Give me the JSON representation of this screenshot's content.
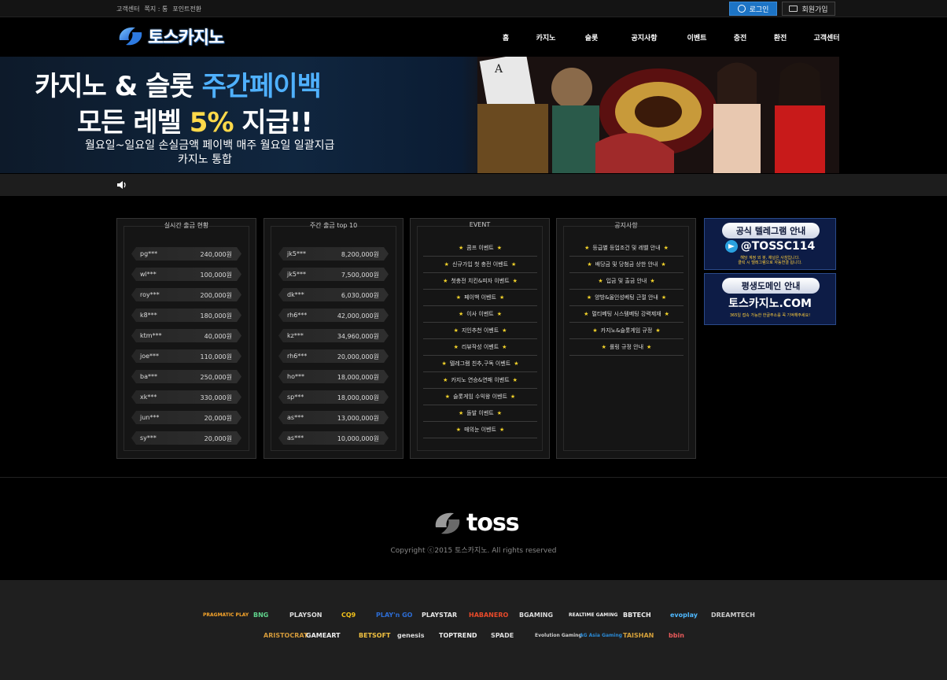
{
  "topbar": {
    "links": [
      "고객센터",
      "쪽지 : 통",
      "포인트전환"
    ],
    "login_label": "로그인",
    "join_label": "회원가입"
  },
  "header": {
    "logo_text": "토스카지노",
    "nav": [
      "홈",
      "카지노",
      "슬롯",
      "공지사항",
      "이벤트",
      "충전",
      "환전",
      "고객센터"
    ]
  },
  "banner": {
    "line1_a": "카지노 & 슬롯 ",
    "line1_b": "주간페이백",
    "line2_a": "모든 레벨 ",
    "line2_b": "5%",
    "line2_c": " 지급!!",
    "line3": "월요일~일요일 손실금액 페이백 매주 월요일 일괄지급",
    "line4": "카지노 통합"
  },
  "panels": {
    "withdraw_live": {
      "title": "실시간 출금 현황",
      "rows": [
        {
          "name": "pg***",
          "amount": "240,000원"
        },
        {
          "name": "wl***",
          "amount": "100,000원"
        },
        {
          "name": "roy***",
          "amount": "200,000원"
        },
        {
          "name": "k8***",
          "amount": "180,000원"
        },
        {
          "name": "ktm***",
          "amount": "40,000원"
        },
        {
          "name": "joe***",
          "amount": "110,000원"
        },
        {
          "name": "ba***",
          "amount": "250,000원"
        },
        {
          "name": "xk***",
          "amount": "330,000원"
        },
        {
          "name": "jun***",
          "amount": "20,000원"
        },
        {
          "name": "sy***",
          "amount": "20,000원"
        }
      ]
    },
    "weekly_top": {
      "title": "주간 출금 top 10",
      "rows": [
        {
          "name": "jk5***",
          "amount": "8,200,000원"
        },
        {
          "name": "jk5***",
          "amount": "7,500,000원"
        },
        {
          "name": "dk***",
          "amount": "6,030,000원"
        },
        {
          "name": "rh6***",
          "amount": "42,000,000원"
        },
        {
          "name": "kz***",
          "amount": "34,960,000원"
        },
        {
          "name": "rh6***",
          "amount": "20,000,000원"
        },
        {
          "name": "ho***",
          "amount": "18,000,000원"
        },
        {
          "name": "sp***",
          "amount": "18,000,000원"
        },
        {
          "name": "as***",
          "amount": "13,000,000원"
        },
        {
          "name": "as***",
          "amount": "10,000,000원"
        }
      ]
    },
    "event": {
      "title": "EVENT",
      "items": [
        "콤프 이벤트",
        "신규가입 첫 충전 이벤트",
        "첫충전 치킨&피자 이벤트",
        "페이백 이벤트",
        "이사 이벤트",
        "지인추천 이벤트",
        "리뷰작성 이벤트",
        "텔레그램 친추,구독 이벤트",
        "카지노 연승&연패 이벤트",
        "슬롯게임 수익왕 이벤트",
        "돌발 이벤트",
        "매의눈 이벤트"
      ]
    },
    "notice": {
      "title": "공지사항",
      "items": [
        "등급별 등업조건 및 레벨 안내",
        "배당금 및 당첨금 상한 안내",
        "입금 및 출금 안내",
        "양방&올인성베팅 근절 안내",
        "멀티베팅 시스템베팅 강력제재",
        "카지노&슬롯게임 규정",
        "롤링 규정 안내"
      ]
    }
  },
  "promos": {
    "telegram": {
      "title": "공식 텔레그램 안내",
      "handle": "@TOSSC114",
      "small1": "해당 계정 외 봇, 채널은 사칭입니다.",
      "small2": "클릭 시 텔레그램으로 자동연결 됩니다."
    },
    "domain": {
      "title": "평생도메인 안내",
      "domain": "토스카지노.COM",
      "small1": "365일 접속 가능한 한글주소를 꼭 기억해주세요!"
    }
  },
  "footer": {
    "logo_text": "toss",
    "copyright": "Copyright ⓒ2015 토스카지노. All rights reserved"
  },
  "providers_row1": [
    {
      "label": "PRAGMATIC PLAY",
      "color": "#f7a52b"
    },
    {
      "label": "BNG",
      "color": "#5fd38b"
    },
    {
      "label": "PLAYSON",
      "color": "#dddddd"
    },
    {
      "label": "CQ9",
      "color": "#f3c21a"
    },
    {
      "label": "PLAY'n GO",
      "color": "#2d6dd4"
    },
    {
      "label": "PLAYSTAR",
      "color": "#e6e6e6"
    },
    {
      "label": "HABANERO",
      "color": "#e84a2a"
    },
    {
      "label": "BGAMING",
      "color": "#dddddd"
    },
    {
      "label": "REALTIME GAMING",
      "color": "#eeeeee"
    },
    {
      "label": "BBTECH",
      "color": "#eeeeee"
    },
    {
      "label": "evoplay",
      "color": "#4fb9ff"
    },
    {
      "label": "DREAMTECH",
      "color": "#cccccc"
    }
  ],
  "providers_row2": [
    {
      "label": "ARISTOCRAT",
      "color": "#d49a3a"
    },
    {
      "label": "GAMEART",
      "color": "#eeeeee"
    },
    {
      "label": "BETSOFT",
      "color": "#f0c040"
    },
    {
      "label": "genesis",
      "color": "#dddddd"
    },
    {
      "label": "TOPTREND",
      "color": "#eeeeee"
    },
    {
      "label": "SPADE",
      "color": "#dddddd"
    },
    {
      "label": "Evolution Gaming",
      "color": "#cccccc"
    },
    {
      "label": "AG Asia Gaming",
      "color": "#2a8ad6"
    },
    {
      "label": "TAISHAN",
      "color": "#d4a03a"
    },
    {
      "label": "bbin",
      "color": "#e85a5a"
    }
  ]
}
